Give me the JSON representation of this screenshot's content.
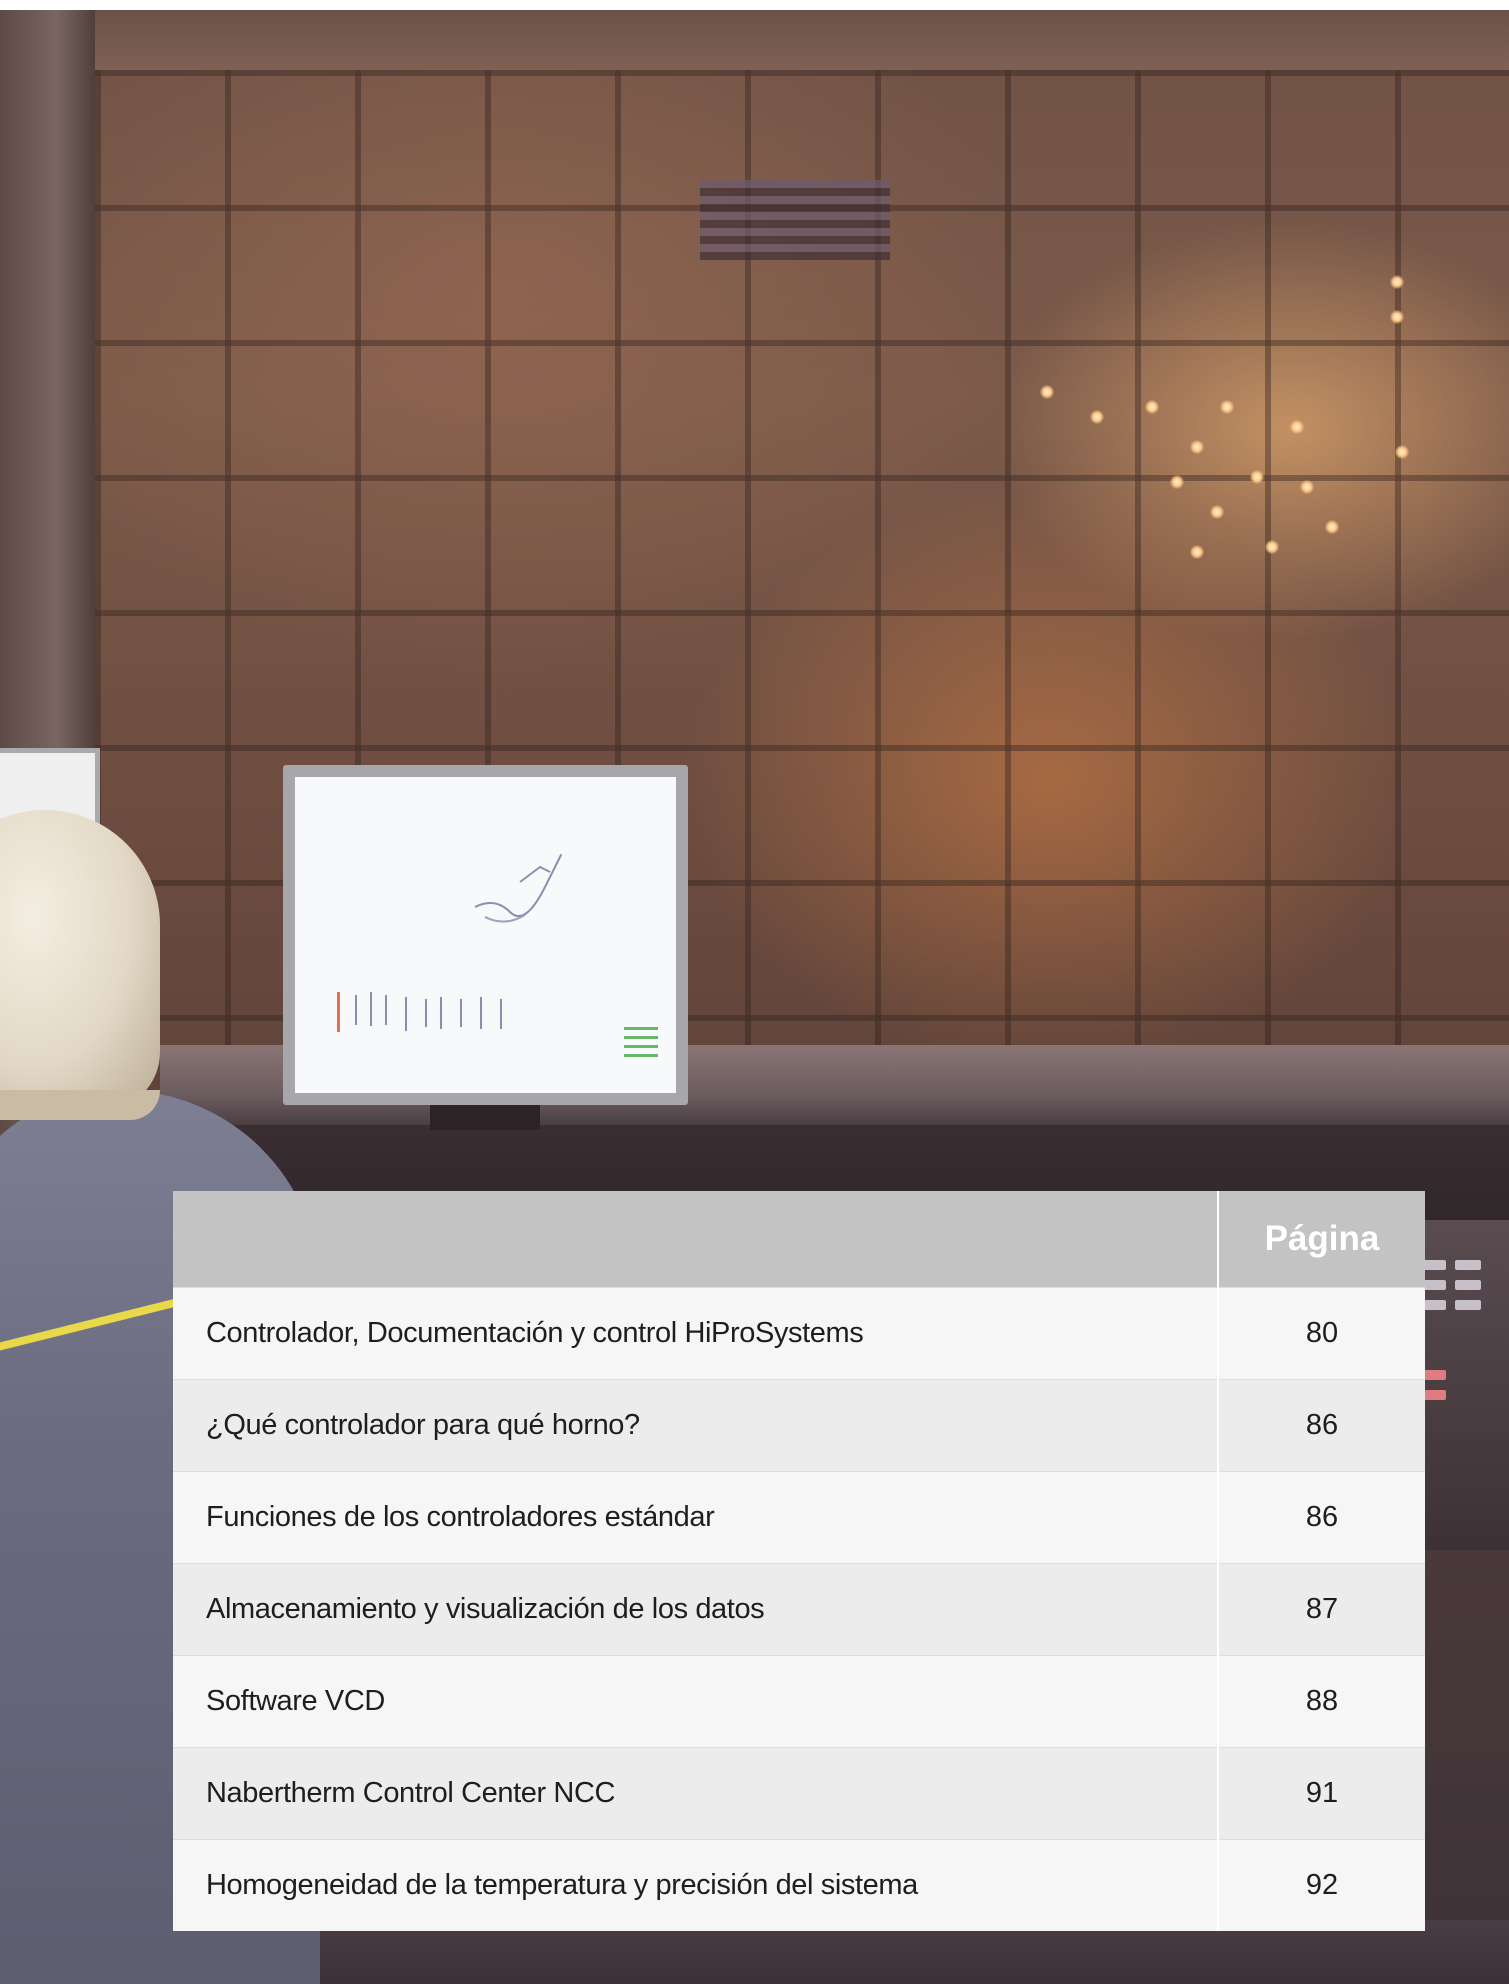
{
  "toc": {
    "page_header": "Página",
    "entries": [
      {
        "title": "Controlador, Documentación y control HiProSystems",
        "page": "80"
      },
      {
        "title": "¿Qué controlador para qué horno?",
        "page": "86"
      },
      {
        "title": "Funciones de los controladores estándar",
        "page": "86"
      },
      {
        "title": "Almacenamiento y visualización de los datos",
        "page": "87"
      },
      {
        "title": "Software VCD",
        "page": "88"
      },
      {
        "title": "Nabertherm Control Center NCC",
        "page": "91"
      },
      {
        "title": "Homogeneidad de la temperatura y precisión del sistema",
        "page": "92"
      }
    ]
  }
}
